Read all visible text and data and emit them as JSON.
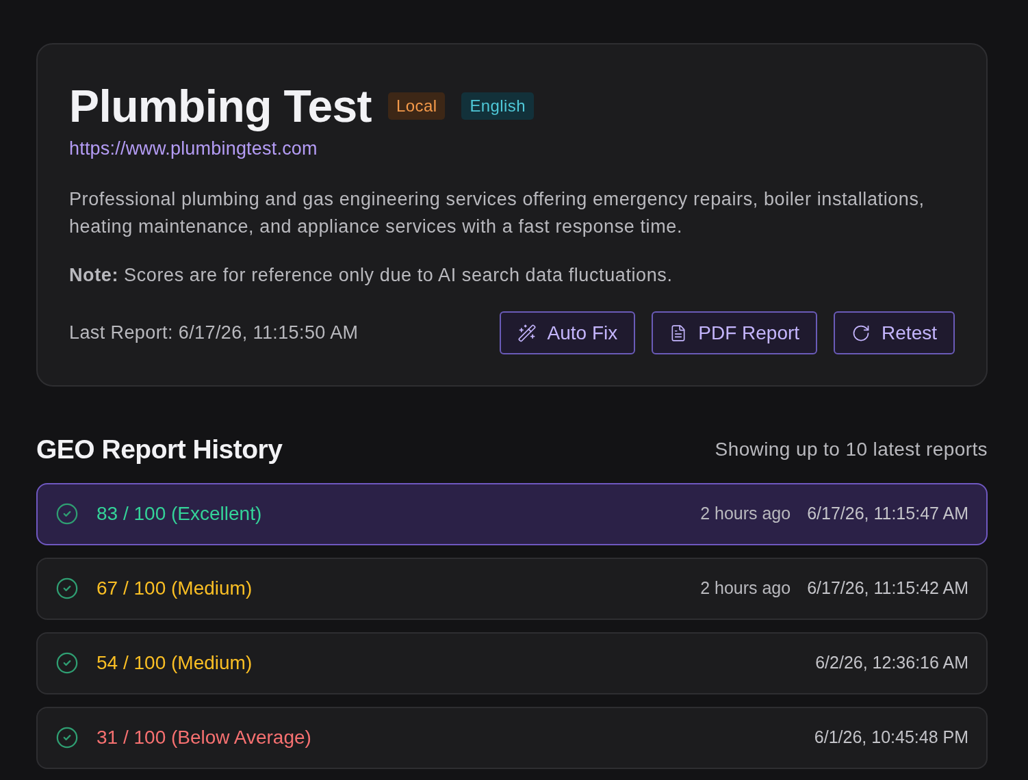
{
  "site": {
    "title": "Plumbing Test",
    "badges": [
      {
        "label": "Local",
        "kind": "type"
      },
      {
        "label": "English",
        "kind": "language"
      }
    ],
    "url": "https://www.plumbingtest.com",
    "description": "Professional plumbing and gas engineering services offering emergency repairs, boiler installations, heating maintenance, and appliance services with a fast response time.",
    "note": "**Note:** Scores are for reference only due to AI search data fluctuations.",
    "last_report": "Last Report: 6/17/26, 11:15:50 AM",
    "actions": [
      {
        "label": "Auto Fix",
        "kind": "autofix"
      },
      {
        "label": "PDF Report",
        "kind": "pdf"
      },
      {
        "label": "Retest",
        "kind": "retest"
      }
    ]
  },
  "history": {
    "title": "GEO Report History",
    "caption": "Showing up to 10 latest reports",
    "reports": [
      {
        "score": "83 / 100 (Excellent)",
        "color": "#34d399",
        "selected": true,
        "relative": "2 hours ago",
        "timestamp": "6/17/26, 11:15:47 AM"
      },
      {
        "score": "67 / 100 (Medium)",
        "color": "#fbbf24",
        "selected": false,
        "relative": "2 hours ago",
        "timestamp": "6/17/26, 11:15:42 AM"
      },
      {
        "score": "54 / 100 (Medium)",
        "color": "#fbbf24",
        "selected": false,
        "timestamp": "6/2/26, 12:36:16 AM"
      },
      {
        "score": "31 / 100 (Below Average)",
        "color": "#f87171",
        "selected": false,
        "timestamp": "6/1/26, 10:45:48 PM"
      }
    ]
  }
}
